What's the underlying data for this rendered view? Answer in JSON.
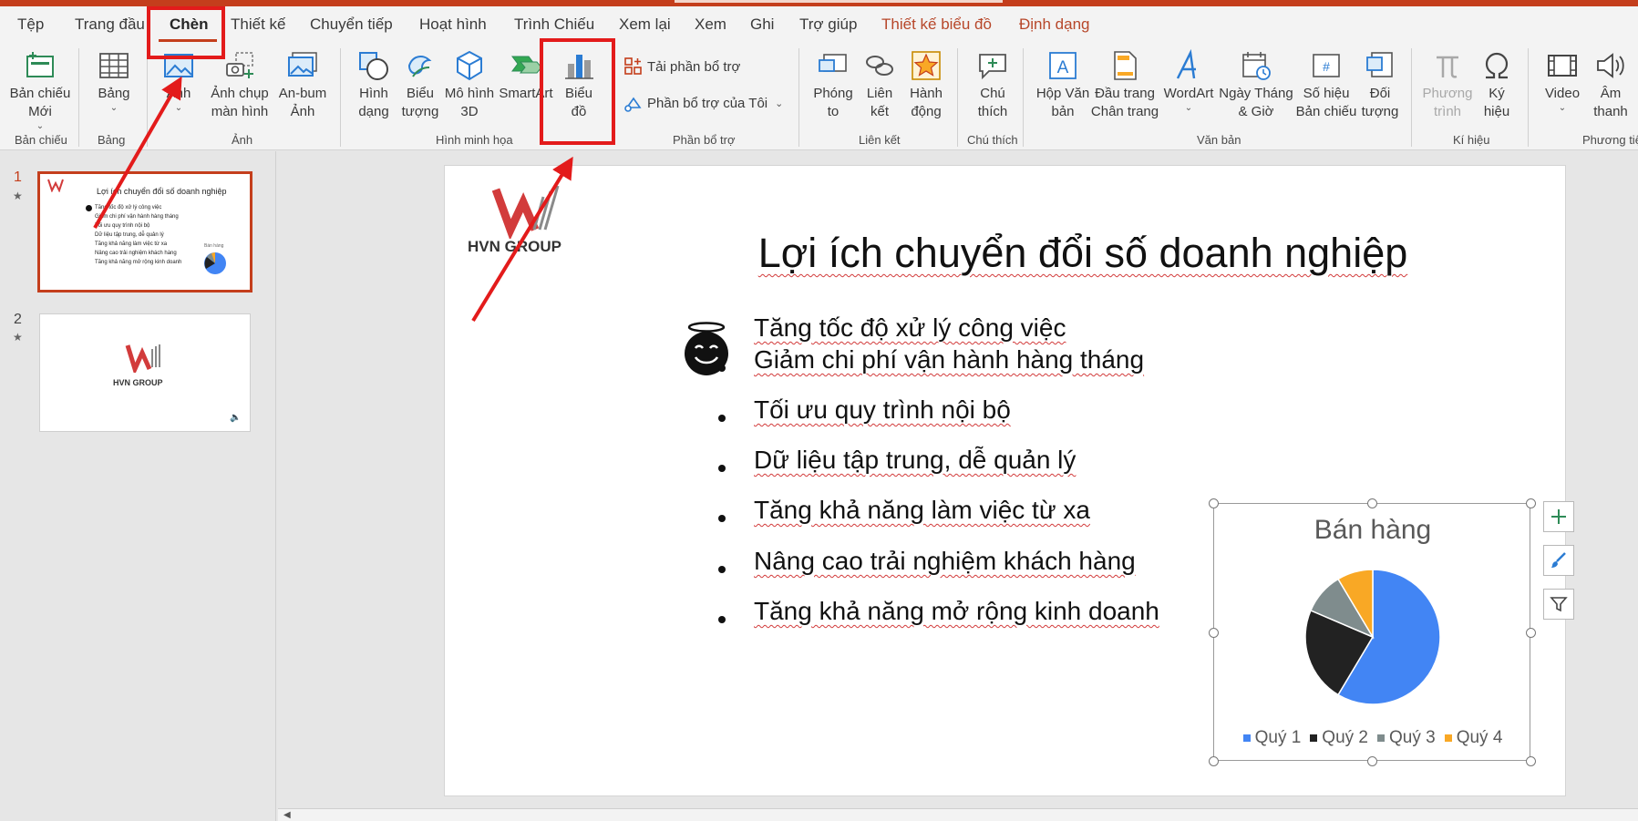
{
  "tabs": [
    "Tệp",
    "Trang đầu",
    "Chèn",
    "Thiết kế",
    "Chuyển tiếp",
    "Hoạt hình",
    "Trình Chiếu",
    "Xem lại",
    "Xem",
    "Ghi",
    "Trợ giúp",
    "Thiết kế biểu đồ",
    "Định dạng"
  ],
  "active_tab": "Chèn",
  "ribbon": {
    "slides": {
      "label1": "Bản chiếu",
      "label2": "Mới",
      "group": "Bản chiếu"
    },
    "table": {
      "label": "Bảng",
      "group": "Bảng"
    },
    "images": {
      "picture": "Ảnh",
      "screenshot1": "Ảnh chụp",
      "screenshot2": "màn hình",
      "album1": "An-bum",
      "album2": "Ảnh",
      "group": "Ảnh"
    },
    "illustrations": {
      "shapes1": "Hình",
      "shapes2": "dạng",
      "icons1": "Biểu",
      "icons2": "tượng",
      "models1": "Mô hình",
      "models2": "3D",
      "smartart": "SmartArt",
      "chart1": "Biểu",
      "chart2": "đồ",
      "group": "Hình minh họa"
    },
    "addins": {
      "get": "Tải phần bổ trợ",
      "my": "Phần bổ trợ của Tôi",
      "group": "Phần bổ trợ"
    },
    "links": {
      "zoom1": "Phóng",
      "zoom2": "to",
      "link1": "Liên",
      "link2": "kết",
      "action1": "Hành",
      "action2": "động",
      "group": "Liên kết"
    },
    "comments": {
      "label1": "Chú",
      "label2": "thích",
      "group": "Chú thích"
    },
    "text": {
      "textbox1": "Hộp Văn",
      "textbox2": "bản",
      "header1": "Đầu trang",
      "header2": "Chân trang",
      "wordart": "WordArt",
      "datetime1": "Ngày Tháng",
      "datetime2": "& Giờ",
      "slidenum1": "Số hiệu",
      "slidenum2": "Bản chiếu",
      "object1": "Đối",
      "object2": "tượng",
      "group": "Văn bản"
    },
    "symbols": {
      "equation1": "Phương",
      "equation2": "trình",
      "symbol1": "Ký",
      "symbol2": "hiệu",
      "group": "Kí hiệu"
    },
    "media": {
      "video": "Video",
      "audio1": "Âm",
      "audio2": "thanh",
      "group": "Phương tiệ"
    }
  },
  "side_panel": {
    "slides": [
      {
        "number": "1",
        "title": "Lợi ích chuyển đổi số doanh nghiệp"
      },
      {
        "number": "2",
        "logo_text": "HVN GROUP"
      }
    ],
    "star": "★"
  },
  "slide": {
    "logo_text": "HVN GROUP",
    "title": "Lợi ích chuyển đổi số doanh nghiệp",
    "bullets": [
      "Tăng tốc độ xử lý công việc",
      "Giảm chi phí vận hành hàng tháng",
      "Tối ưu quy trình nội bộ",
      "Dữ liệu tập trung, dễ quản lý",
      "Tăng khả năng làm việc từ xa",
      "Nâng cao trải nghiệm khách hàng",
      "Tăng khả năng mở rộng kinh doanh"
    ]
  },
  "chart_data": {
    "type": "pie",
    "title": "Bán hàng",
    "categories": [
      "Quý 1",
      "Quý 2",
      "Quý 3",
      "Quý 4"
    ],
    "values": [
      8.2,
      3.2,
      1.4,
      1.2
    ],
    "colors": [
      "#4285f4",
      "#222222",
      "#7f8c8d",
      "#f9a825"
    ],
    "legend": "bottom"
  },
  "colors": {
    "accent": "#c43e1c",
    "annotation": "#e31b1b"
  }
}
